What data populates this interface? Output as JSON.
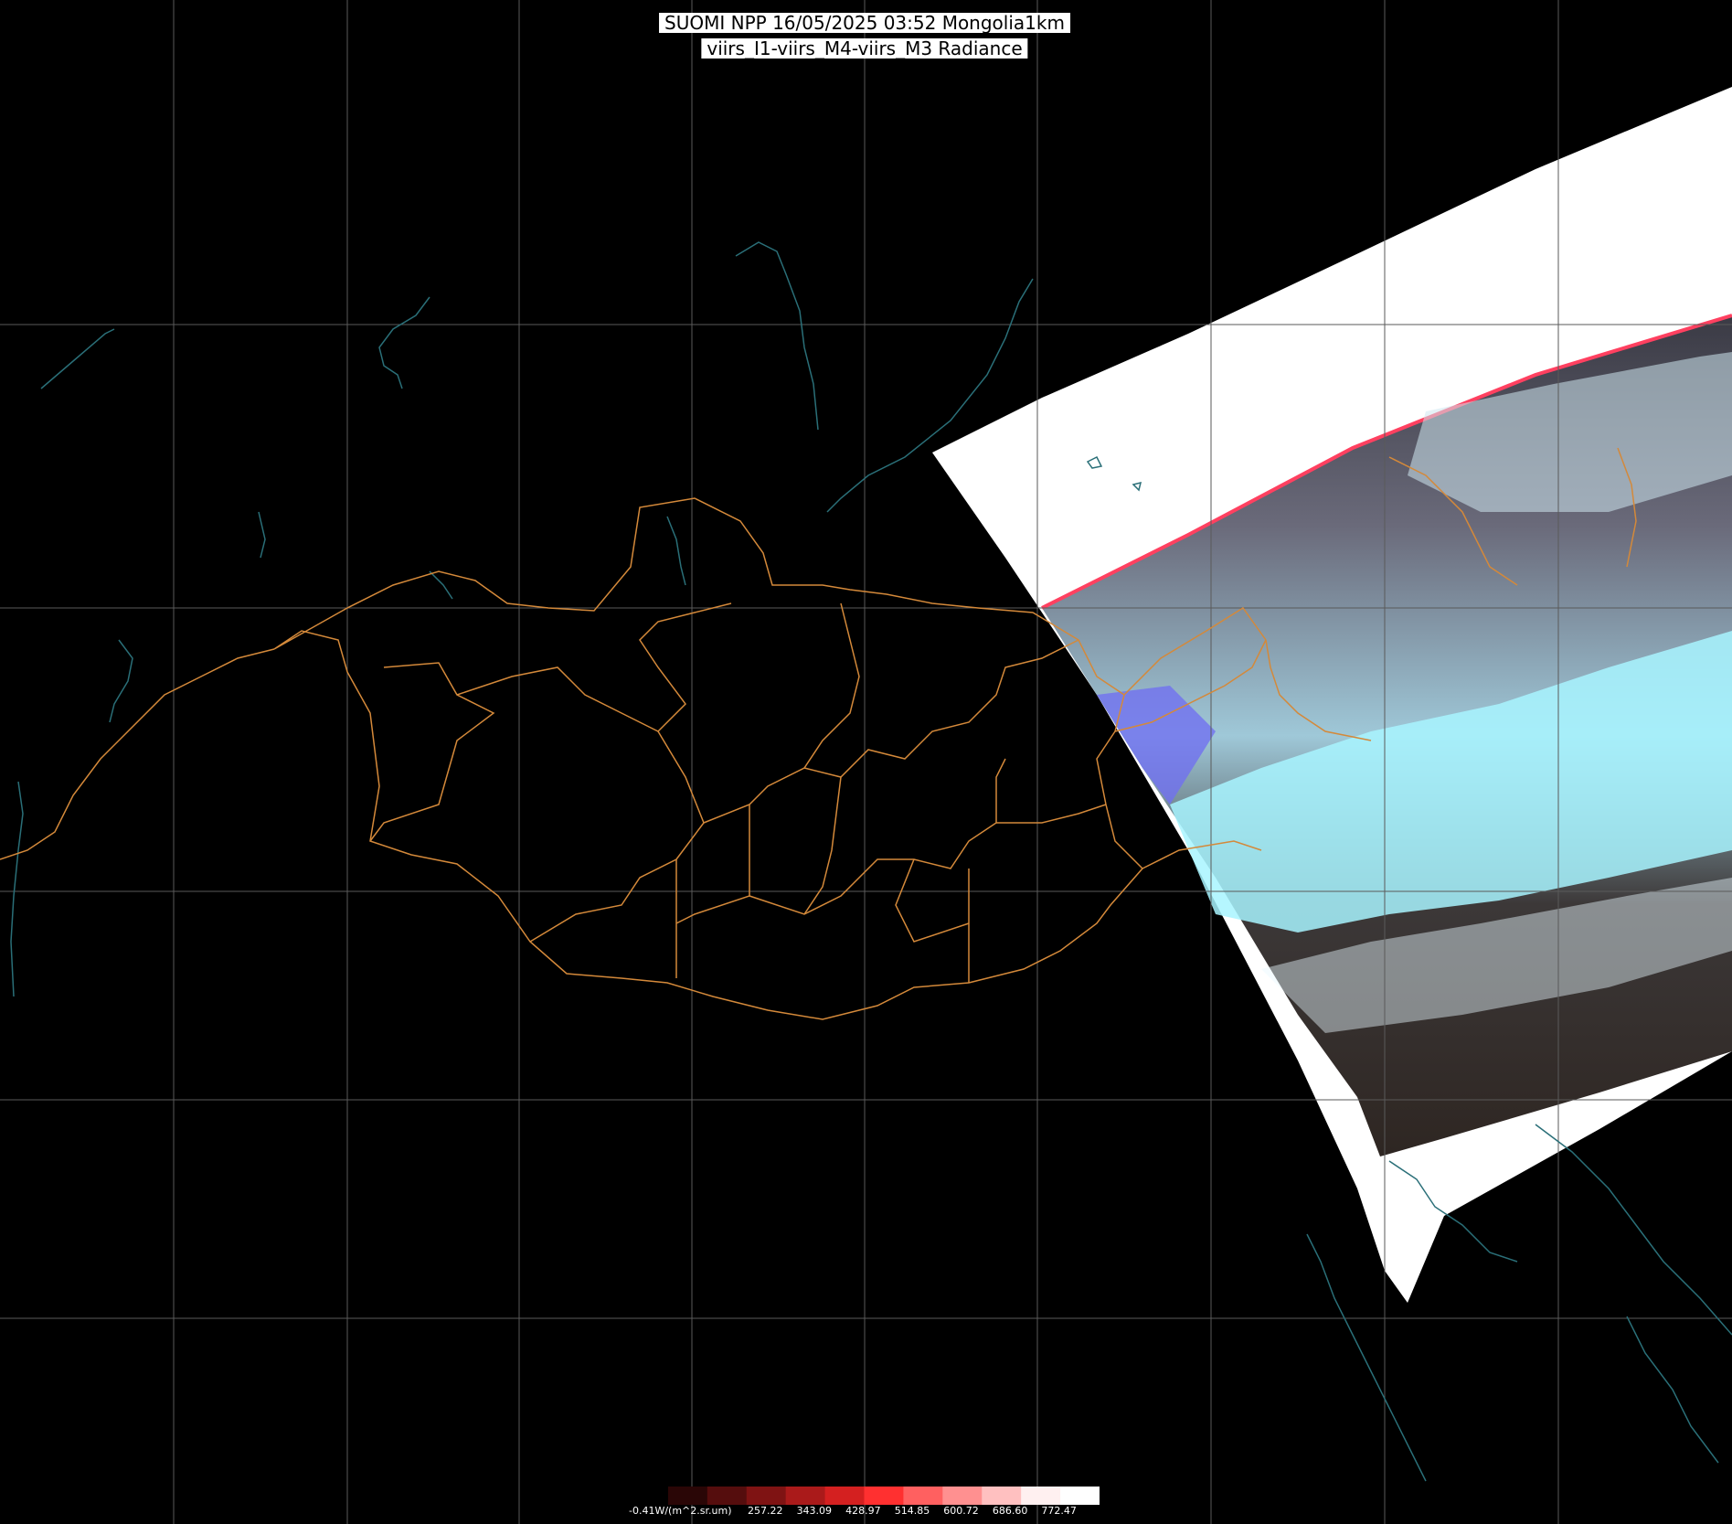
{
  "title": {
    "line1": "SUOMI NPP 16/05/2025 03:52 Mongolia1km",
    "line2": "viirs_I1-viirs_M4-viirs_M3 Radiance"
  },
  "colorbar": {
    "unit_label": "-0.41W/(m^2.sr.um)",
    "ticks": [
      "257.22",
      "343.09",
      "428.97",
      "514.85",
      "600.72",
      "686.60",
      "772.47"
    ],
    "colors": [
      "#000000",
      "#2a0606",
      "#550d0d",
      "#7f1313",
      "#aa1a1a",
      "#d42020",
      "#ff3030",
      "#ff6060",
      "#ff9090",
      "#ffc0c0",
      "#fff0f0",
      "#ffffff"
    ]
  },
  "colors": {
    "background": "#000000",
    "gridlines": "#5a5a5a",
    "admin_borders": "#d4893a",
    "coastlines_rivers": "#2a6f78",
    "swath_nodata": "#ffffff",
    "cloud_cyan": "#a8f4ff",
    "cloud_violet": "#7070f0"
  }
}
